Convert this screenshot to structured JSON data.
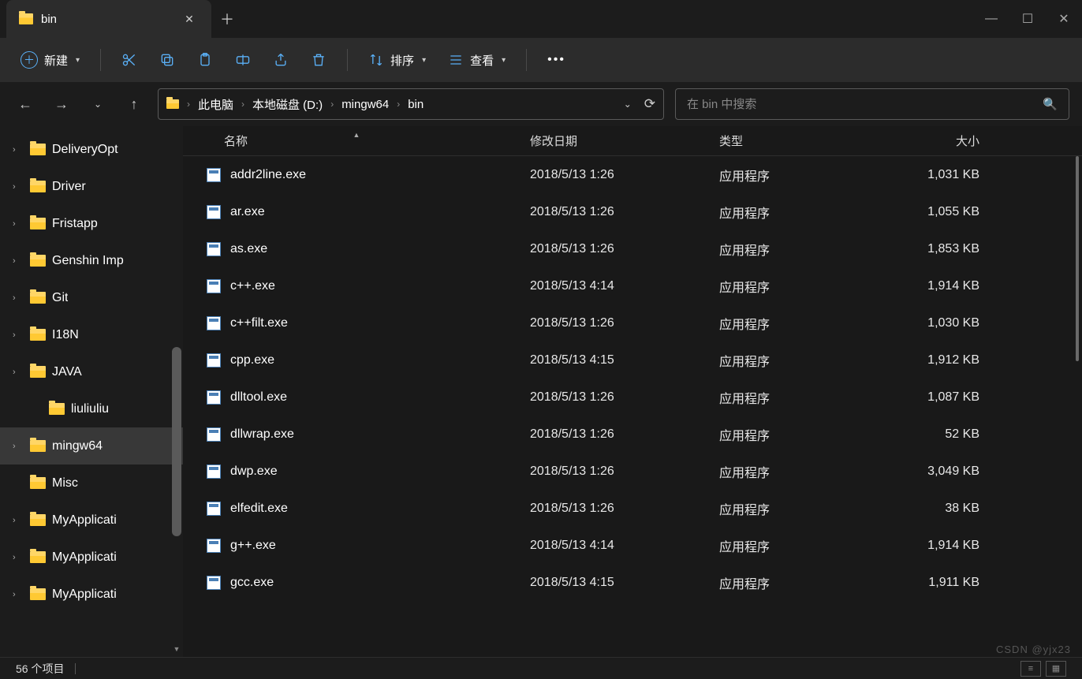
{
  "window": {
    "tab_title": "bin",
    "min": "—",
    "max": "☐",
    "close": "✕"
  },
  "toolbar": {
    "new_label": "新建",
    "sort_label": "排序",
    "view_label": "查看"
  },
  "breadcrumb": {
    "items": [
      "此电脑",
      "本地磁盘 (D:)",
      "mingw64",
      "bin"
    ]
  },
  "search": {
    "placeholder": "在 bin 中搜索"
  },
  "sidebar": {
    "items": [
      {
        "label": "DeliveryOpt",
        "expandable": true
      },
      {
        "label": "Driver",
        "expandable": true
      },
      {
        "label": "Fristapp",
        "expandable": true
      },
      {
        "label": "Genshin Imp",
        "expandable": true
      },
      {
        "label": "Git",
        "expandable": true
      },
      {
        "label": "I18N",
        "expandable": true
      },
      {
        "label": "JAVA",
        "expandable": true
      },
      {
        "label": "liuliuliu",
        "expandable": false,
        "child": true
      },
      {
        "label": "mingw64",
        "expandable": true,
        "selected": true
      },
      {
        "label": "Misc",
        "expandable": false
      },
      {
        "label": "MyApplicati",
        "expandable": true
      },
      {
        "label": "MyApplicati",
        "expandable": true
      },
      {
        "label": "MyApplicati",
        "expandable": true
      }
    ]
  },
  "columns": {
    "name": "名称",
    "date": "修改日期",
    "type": "类型",
    "size": "大小"
  },
  "files": [
    {
      "name": "addr2line.exe",
      "date": "2018/5/13 1:26",
      "type": "应用程序",
      "size": "1,031 KB"
    },
    {
      "name": "ar.exe",
      "date": "2018/5/13 1:26",
      "type": "应用程序",
      "size": "1,055 KB"
    },
    {
      "name": "as.exe",
      "date": "2018/5/13 1:26",
      "type": "应用程序",
      "size": "1,853 KB"
    },
    {
      "name": "c++.exe",
      "date": "2018/5/13 4:14",
      "type": "应用程序",
      "size": "1,914 KB"
    },
    {
      "name": "c++filt.exe",
      "date": "2018/5/13 1:26",
      "type": "应用程序",
      "size": "1,030 KB"
    },
    {
      "name": "cpp.exe",
      "date": "2018/5/13 4:15",
      "type": "应用程序",
      "size": "1,912 KB"
    },
    {
      "name": "dlltool.exe",
      "date": "2018/5/13 1:26",
      "type": "应用程序",
      "size": "1,087 KB"
    },
    {
      "name": "dllwrap.exe",
      "date": "2018/5/13 1:26",
      "type": "应用程序",
      "size": "52 KB"
    },
    {
      "name": "dwp.exe",
      "date": "2018/5/13 1:26",
      "type": "应用程序",
      "size": "3,049 KB"
    },
    {
      "name": "elfedit.exe",
      "date": "2018/5/13 1:26",
      "type": "应用程序",
      "size": "38 KB"
    },
    {
      "name": "g++.exe",
      "date": "2018/5/13 4:14",
      "type": "应用程序",
      "size": "1,914 KB"
    },
    {
      "name": "gcc.exe",
      "date": "2018/5/13 4:15",
      "type": "应用程序",
      "size": "1,911 KB"
    }
  ],
  "status": {
    "text": "56 个项目"
  },
  "watermark": "CSDN @yjx23"
}
